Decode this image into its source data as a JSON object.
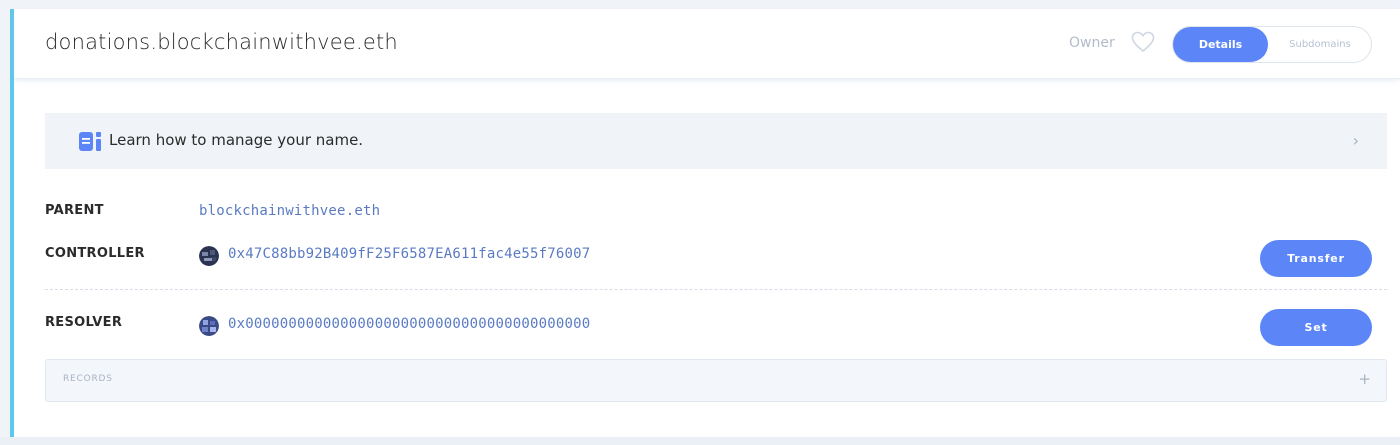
{
  "header": {
    "title": "donations.blockchainwithvee.eth",
    "owner_label": "Owner",
    "favorite_icon": "heart-icon",
    "tabs": [
      {
        "label": "Details",
        "active": true
      },
      {
        "label": "Subdomains",
        "active": false
      }
    ]
  },
  "banner": {
    "icon": "book-icon",
    "text": "Learn how to manage your name.",
    "chevron": "›"
  },
  "details": {
    "parent": {
      "label": "PARENT",
      "value": "blockchainwithvee.eth"
    },
    "controller": {
      "label": "CONTROLLER",
      "value": "0x47C88bb92B409fF25F6587EA611fac4e55f76007",
      "button": "Transfer"
    },
    "resolver": {
      "label": "RESOLVER",
      "value": "0x0000000000000000000000000000000000000000",
      "button": "Set"
    }
  },
  "records": {
    "label": "RECORDS",
    "add": "+"
  },
  "colors": {
    "accent": "#5c86f7",
    "address": "#5a7bc4",
    "card_border": "#5cc8ec",
    "banner_bg": "#f0f4f9"
  }
}
